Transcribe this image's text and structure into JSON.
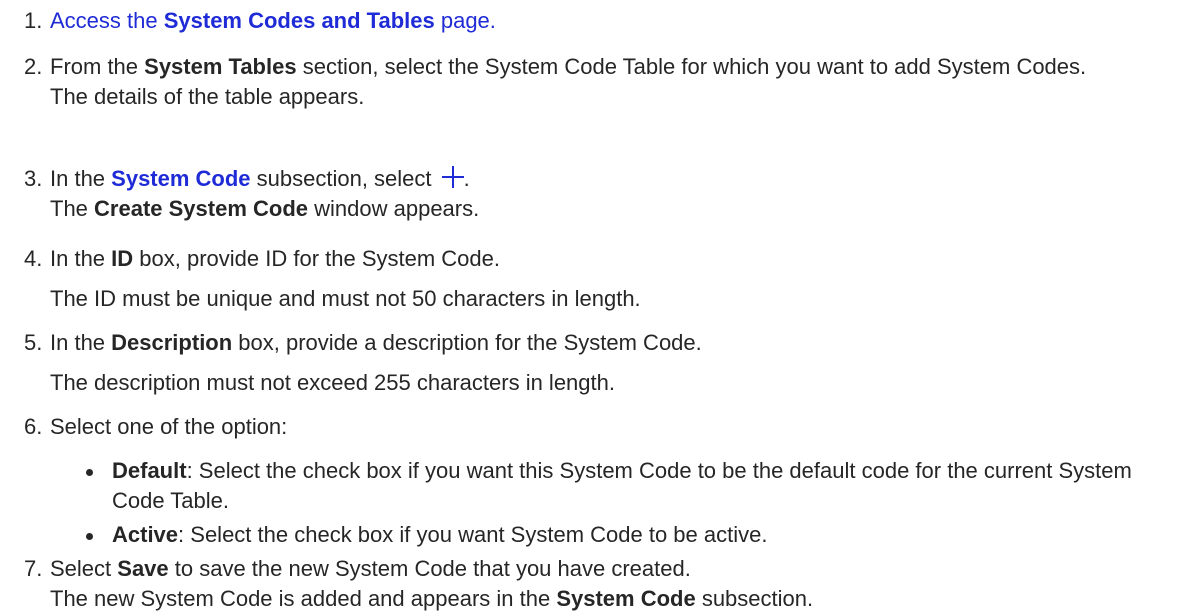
{
  "steps": [
    {
      "num": "1.",
      "pre": "Access the ",
      "bold": "System Codes and Tables",
      "post": " page."
    },
    {
      "num": "2.",
      "pre": "From the ",
      "bold": "System Tables",
      "post": " section, select the System Code Table for which you want to add System Codes.",
      "result": "The details of the table appears."
    },
    {
      "num": "3.",
      "pre": "In the ",
      "bold": "System Code",
      "post": " subsection, select ",
      "tail": ".",
      "result_bold": "Create System Code",
      "result_post": " window appears.",
      "result_pre": "The ",
      "icon": "plus-icon"
    },
    {
      "num": "4.",
      "pre": "In the ",
      "bold": "ID",
      "post": " box, provide ID for the System Code.",
      "note": "The ID must be unique and must not 50 characters in length."
    },
    {
      "num": "5.",
      "pre": "In the ",
      "bold": "Description",
      "post": " box, provide a description for the System Code.",
      "note": "The description must not exceed 255 characters in length."
    },
    {
      "num": "6.",
      "text": "Select one of the option:",
      "options": [
        {
          "bold": "Default",
          "text": ": Select the check box if you want this System Code to be the default code for the current System Code Table."
        },
        {
          "bold": "Active",
          "text": ": Select the check box if you want System Code to be active."
        }
      ]
    },
    {
      "num": "7.",
      "pre": "Select ",
      "bold": "Save",
      "post": " to save the new System Code that you have created.",
      "result_pre": "The new System Code is added and appears in the ",
      "result_bold": "System Code",
      "result_post": " subsection."
    }
  ],
  "colors": {
    "link": "#1f2bd6",
    "text": "#262626",
    "background": "#ffffff"
  }
}
